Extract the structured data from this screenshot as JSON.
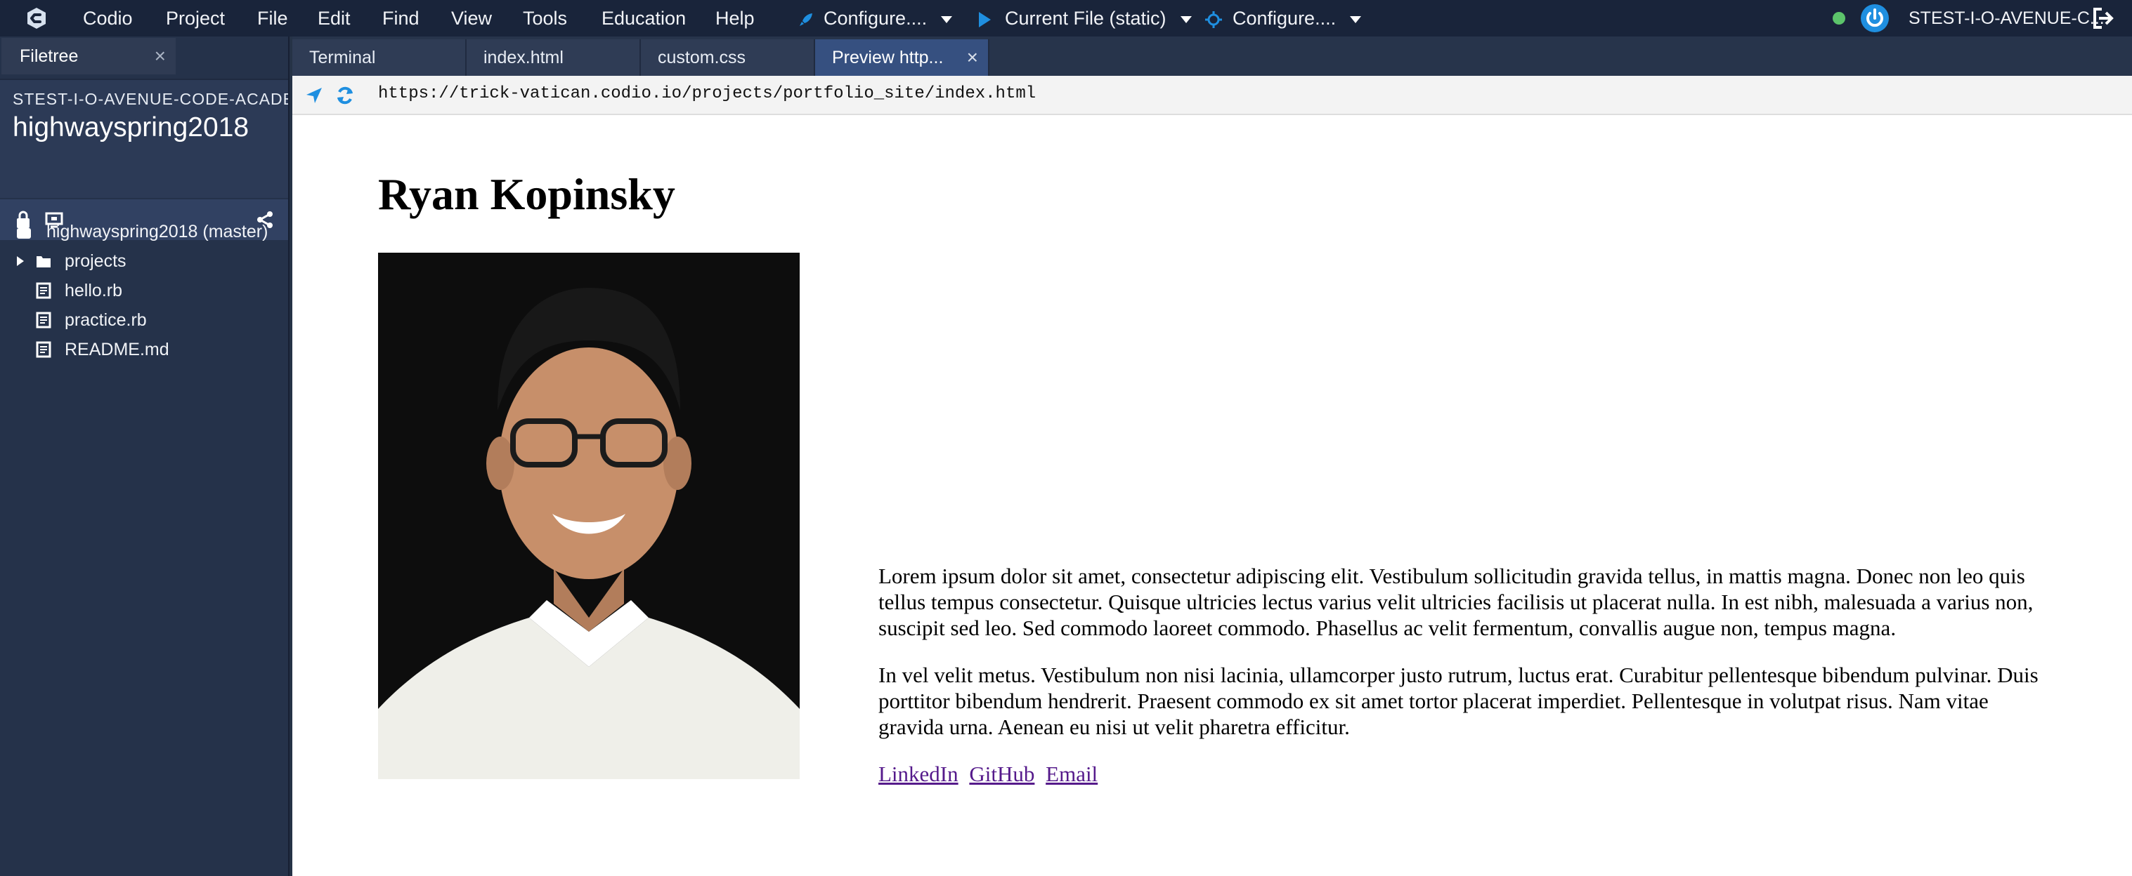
{
  "menubar": {
    "items": [
      "Codio",
      "Project",
      "File",
      "Edit",
      "Find",
      "View",
      "Tools",
      "Education",
      "Help"
    ],
    "configure1": "Configure....",
    "run_target": "Current File (static)",
    "configure2": "Configure....",
    "user": "STEST-I-O-AVENUE-C..."
  },
  "filetree": {
    "tab_label": "Filetree",
    "close": "×",
    "org": "STEST-I-O-AVENUE-CODE-ACADEM",
    "project": "highwayspring2018",
    "root": "highwayspring2018 (master)",
    "items": [
      "projects",
      "hello.rb",
      "practice.rb",
      "README.md"
    ]
  },
  "editor_tabs": {
    "items": [
      "Terminal",
      "index.html",
      "custom.css",
      "Preview http..."
    ],
    "close": "×"
  },
  "browser": {
    "url": "https://trick-vatican.codio.io/projects/portfolio_site/index.html"
  },
  "page": {
    "title": "Ryan Kopinsky",
    "paragraph1": "Lorem ipsum dolor sit amet, consectetur adipiscing elit. Vestibulum sollicitudin gravida tellus, in mattis magna. Donec non leo quis tellus tempus consectetur. Quisque ultricies lectus varius velit ultricies facilisis ut placerat nulla. In est nibh, malesuada a varius non, suscipit sed leo. Sed commodo laoreet commodo. Phasellus ac velit fermentum, convallis augue non, tempus magna.",
    "paragraph2": "In vel velit metus. Vestibulum non nisi lacinia, ullamcorper justo rutrum, luctus erat. Curabitur pellentesque bibendum pulvinar. Duis porttitor bibendum hendrerit. Praesent commodo ex sit amet tortor placerat imperdiet. Pellentesque in volutpat risus. Nam vitae gravida urna. Aenean eu nisi ut velit pharetra efficitur.",
    "links": [
      "LinkedIn",
      "GitHub",
      "Email"
    ]
  },
  "icons": {
    "logo": "codio-logo-icon",
    "rocket": "rocket-icon",
    "play": "play-icon",
    "target": "target-icon",
    "power": "power-icon",
    "logout": "logout-icon"
  },
  "colors": {
    "accent": "#1f8fe0",
    "status_online": "#5cc46b",
    "link_visited": "#551a8b"
  }
}
